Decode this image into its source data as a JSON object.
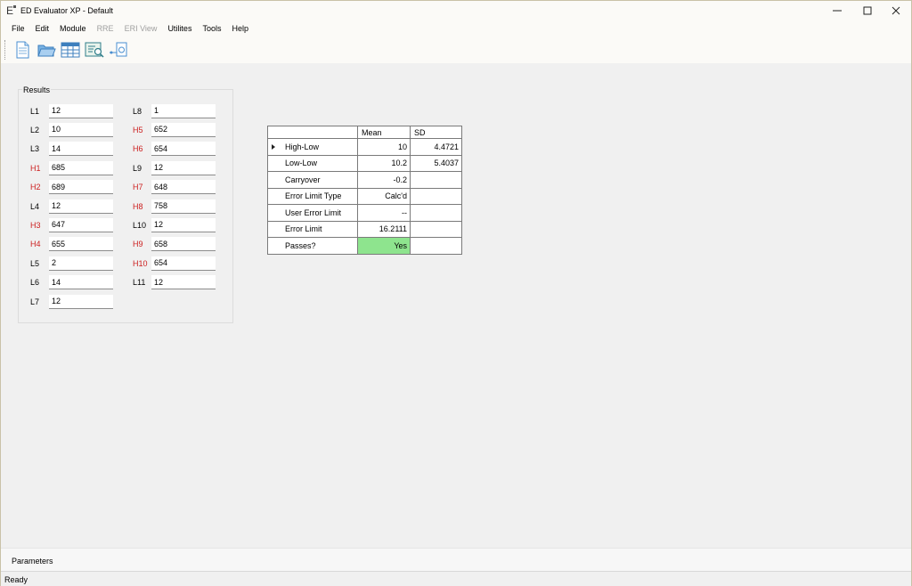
{
  "window": {
    "title": "ED Evaluator XP - Default",
    "icon_glyph": "E",
    "controls": [
      "minimize-icon",
      "maximize-icon",
      "close-icon"
    ]
  },
  "menu": [
    {
      "label": "File",
      "enabled": true
    },
    {
      "label": "Edit",
      "enabled": true
    },
    {
      "label": "Module",
      "enabled": true
    },
    {
      "label": "RRE",
      "enabled": false
    },
    {
      "label": "ERI View",
      "enabled": false
    },
    {
      "label": "Utilites",
      "enabled": true
    },
    {
      "label": "Tools",
      "enabled": true
    },
    {
      "label": "Help",
      "enabled": true
    }
  ],
  "toolbar": [
    "new-document-icon",
    "open-folder-icon",
    "table-view-icon",
    "report-search-icon",
    "export-icon"
  ],
  "results": {
    "title": "Results",
    "left_column": [
      {
        "label": "L1",
        "value": "12",
        "type": "L"
      },
      {
        "label": "L2",
        "value": "10",
        "type": "L"
      },
      {
        "label": "L3",
        "value": "14",
        "type": "L"
      },
      {
        "label": "H1",
        "value": "685",
        "type": "H"
      },
      {
        "label": "H2",
        "value": "689",
        "type": "H"
      },
      {
        "label": "L4",
        "value": "12",
        "type": "L"
      },
      {
        "label": "H3",
        "value": "647",
        "type": "H"
      },
      {
        "label": "H4",
        "value": "655",
        "type": "H"
      },
      {
        "label": "L5",
        "value": "2",
        "type": "L"
      },
      {
        "label": "L6",
        "value": "14",
        "type": "L"
      },
      {
        "label": "L7",
        "value": "12",
        "type": "L"
      }
    ],
    "right_column": [
      {
        "label": "L8",
        "value": "1",
        "type": "L"
      },
      {
        "label": "H5",
        "value": "652",
        "type": "H"
      },
      {
        "label": "H6",
        "value": "654",
        "type": "H"
      },
      {
        "label": "L9",
        "value": "12",
        "type": "L"
      },
      {
        "label": "H7",
        "value": "648",
        "type": "H"
      },
      {
        "label": "H8",
        "value": "758",
        "type": "H"
      },
      {
        "label": "L10",
        "value": "12",
        "type": "L"
      },
      {
        "label": "H9",
        "value": "658",
        "type": "H"
      },
      {
        "label": "H10",
        "value": "654",
        "type": "H"
      },
      {
        "label": "L11",
        "value": "12",
        "type": "L"
      }
    ]
  },
  "summary_grid": {
    "headers": [
      "",
      "Mean",
      "SD"
    ],
    "rows": [
      {
        "label": "High-Low",
        "mean": "10",
        "sd": "4.4721",
        "current": true
      },
      {
        "label": "Low-Low",
        "mean": "10.2",
        "sd": "5.4037"
      },
      {
        "label": "Carryover",
        "mean": "-0.2",
        "sd": ""
      },
      {
        "label": "Error Limit Type",
        "mean": "Calc'd",
        "sd": ""
      },
      {
        "label": "User Error Limit",
        "mean": "--",
        "sd": ""
      },
      {
        "label": "Error Limit",
        "mean": "16.2111",
        "sd": ""
      },
      {
        "label": "Passes?",
        "mean": "Yes",
        "sd": "",
        "pass": true
      }
    ],
    "pass_color": "#8ee48e"
  },
  "parameters_label": "Parameters",
  "status": "Ready",
  "colors": {
    "h_label": "#cc1f1f",
    "window_bg": "#f0f0f0",
    "chrome_bg": "#fbfaf7"
  }
}
